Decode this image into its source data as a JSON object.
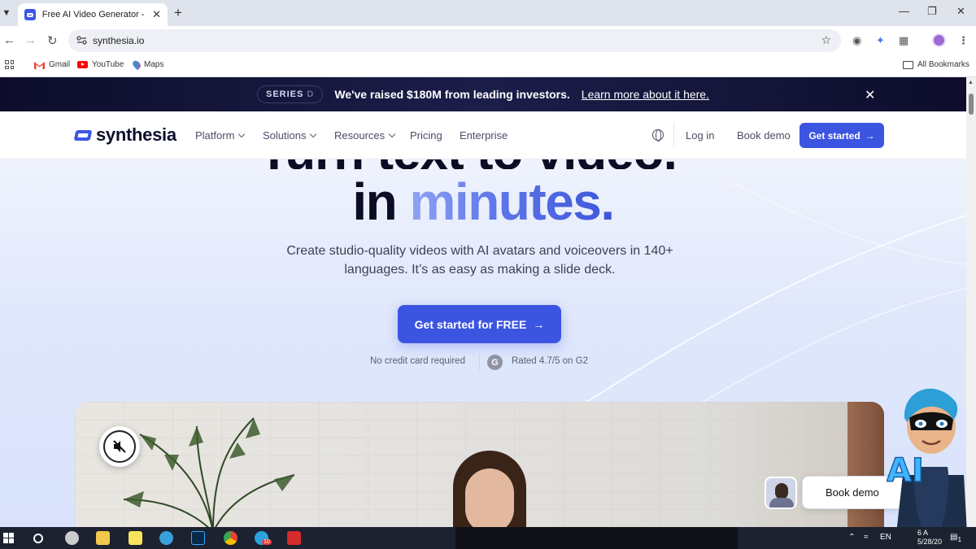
{
  "browser": {
    "tab_title": "Free AI Video Generator - Create",
    "url": "synthesia.io",
    "bookmarks": [
      {
        "label": "Gmail",
        "icon": "gmail-icon"
      },
      {
        "label": "YouTube",
        "icon": "youtube-icon"
      },
      {
        "label": "Maps",
        "icon": "maps-icon"
      }
    ],
    "all_bookmarks": "All Bookmarks"
  },
  "announcement": {
    "badge_main": "SERIES",
    "badge_letter": "D",
    "text": "We've raised $180M from leading investors.",
    "link": "Learn more about it here."
  },
  "header": {
    "logo": "synthesia",
    "nav": [
      {
        "label": "Platform",
        "dropdown": true
      },
      {
        "label": "Solutions",
        "dropdown": true
      },
      {
        "label": "Resources",
        "dropdown": true
      },
      {
        "label": "Pricing",
        "dropdown": false
      },
      {
        "label": "Enterprise",
        "dropdown": false
      }
    ],
    "login": "Log in",
    "book_demo": "Book demo",
    "get_started": "Get started"
  },
  "hero": {
    "headline_cut": "Turn text to video,",
    "headline_plain": "in ",
    "headline_accent": "minutes.",
    "subtitle_line1": "Create studio-quality videos with AI avatars and voiceovers in 140+",
    "subtitle_line2": "languages. It’s as easy as making a slide deck.",
    "cta": "Get started for FREE",
    "no_card": "No credit card required",
    "g2_letter": "G",
    "rating": "Rated 4.7/5 on G2"
  },
  "floating": {
    "book_demo": "Book demo",
    "mascot_text": "AI"
  },
  "taskbar": {
    "telegram_badge": "10",
    "lang": "EN",
    "clock_time": "6 A",
    "clock_date": "5/28/20",
    "notif_count": "1"
  },
  "colors": {
    "brand": "#3c55e0",
    "announcement_bg": "#15163a",
    "headline": "#0c0d24"
  }
}
